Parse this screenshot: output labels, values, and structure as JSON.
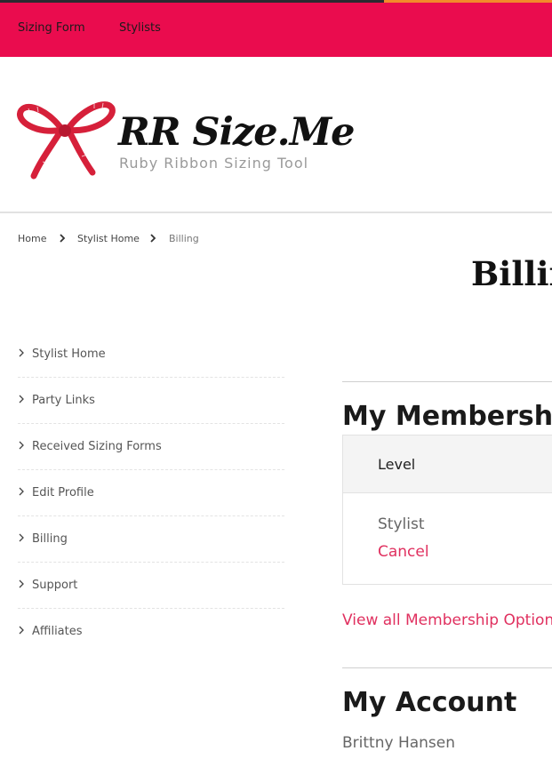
{
  "nav": {
    "items": [
      {
        "label": "Sizing Form"
      },
      {
        "label": "Stylists"
      }
    ]
  },
  "logo": {
    "title": "RR Size.Me",
    "subtitle": "Ruby Ribbon Sizing Tool",
    "icon": "ribbon-bow-icon"
  },
  "breadcrumb": {
    "items": [
      {
        "label": "Home"
      },
      {
        "label": "Stylist Home"
      },
      {
        "label": "Billing"
      }
    ]
  },
  "page": {
    "title": "Billing"
  },
  "sidebar": {
    "items": [
      {
        "label": "Stylist Home"
      },
      {
        "label": "Party Links"
      },
      {
        "label": "Received Sizing Forms"
      },
      {
        "label": "Edit Profile"
      },
      {
        "label": "Billing"
      },
      {
        "label": "Support"
      },
      {
        "label": "Affiliates"
      }
    ]
  },
  "membership": {
    "heading": "My Memberships",
    "column_header": "Level",
    "level": "Stylist",
    "cancel_label": "Cancel",
    "view_all_label": "View all Membership Options"
  },
  "account": {
    "heading": "My Account",
    "name": "Brittny Hansen"
  },
  "colors": {
    "brand": "#ea0c4e",
    "link": "#e0305f",
    "accent_line": "#f28a2a"
  }
}
